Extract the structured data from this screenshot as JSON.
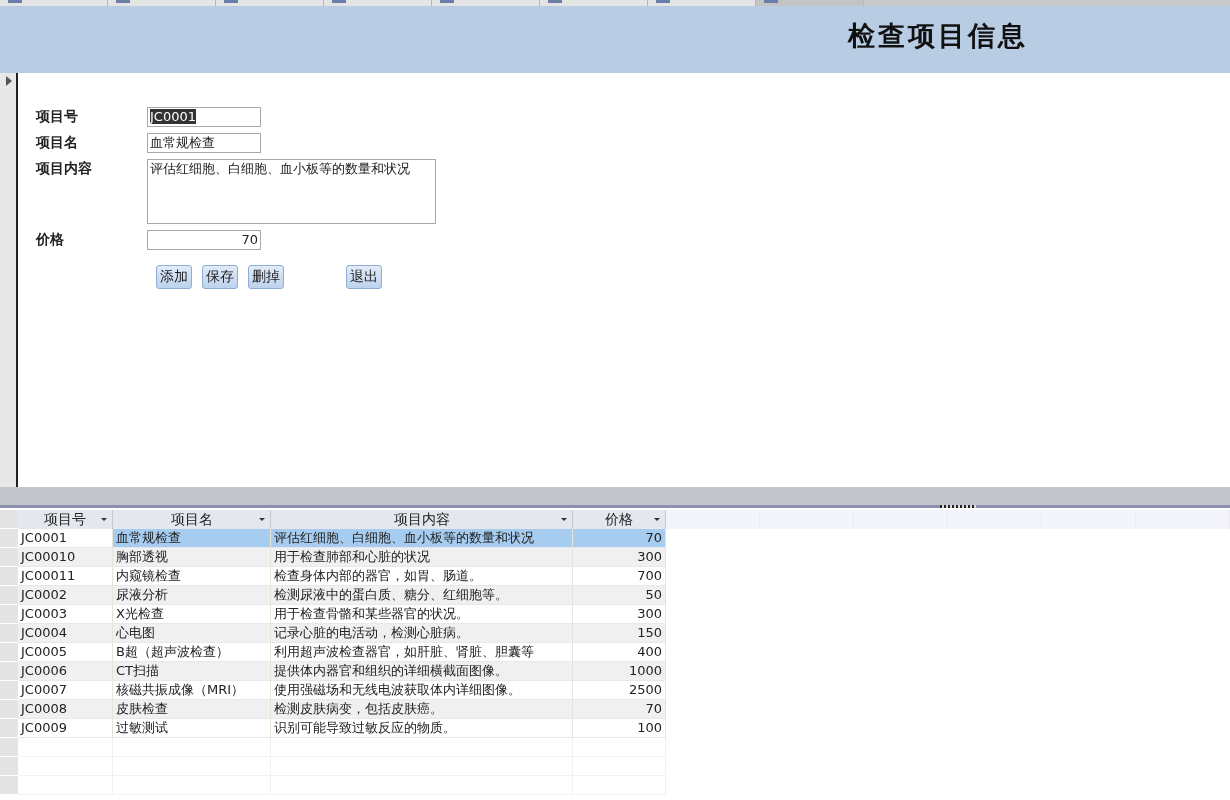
{
  "document_tabs": [
    {
      "selected": false
    },
    {
      "selected": false
    },
    {
      "selected": false
    },
    {
      "selected": false
    },
    {
      "selected": false
    },
    {
      "selected": false
    },
    {
      "selected": false
    },
    {
      "selected": true
    }
  ],
  "header": {
    "title": "检查项目信息"
  },
  "form": {
    "fields": [
      {
        "label": "项目号",
        "kind": "text",
        "value": "JC0001",
        "highlighted": true
      },
      {
        "label": "项目名",
        "kind": "text",
        "value": "血常规检查",
        "highlighted": false
      },
      {
        "label": "项目内容",
        "kind": "textarea",
        "value": "评估红细胞、白细胞、血小板等的数量和状况",
        "highlighted": false
      },
      {
        "label": "价格",
        "kind": "number",
        "value": "70",
        "highlighted": false
      }
    ],
    "buttons": [
      "添加",
      "保存",
      "删掉",
      "退出"
    ]
  },
  "table": {
    "columns": [
      "项目号",
      "项目名",
      "项目内容",
      "价格"
    ],
    "rows": [
      {
        "cells": [
          "JC0001",
          "血常规检查",
          "评估红细胞、白细胞、血小板等的数量和状况",
          "70"
        ],
        "selected": true
      },
      {
        "cells": [
          "JC00010",
          "胸部透视",
          "用于检查肺部和心脏的状况",
          "300"
        ],
        "selected": false
      },
      {
        "cells": [
          "JC00011",
          "内窥镜检查",
          "检查身体内部的器官，如胃、肠道。",
          "700"
        ],
        "selected": false
      },
      {
        "cells": [
          "JC0002",
          "尿液分析",
          "检测尿液中的蛋白质、糖分、红细胞等。",
          "50"
        ],
        "selected": false
      },
      {
        "cells": [
          "JC0003",
          "X光检查",
          "用于检查骨骼和某些器官的状况。",
          "300"
        ],
        "selected": false
      },
      {
        "cells": [
          "JC0004",
          "心电图",
          "记录心脏的电活动，检测心脏病。",
          "150"
        ],
        "selected": false
      },
      {
        "cells": [
          "JC0005",
          "B超（超声波检查）",
          "利用超声波检查器官，如肝脏、肾脏、胆囊等",
          "400"
        ],
        "selected": false
      },
      {
        "cells": [
          "JC0006",
          "CT扫描",
          "提供体内器官和组织的详细横截面图像。",
          "1000"
        ],
        "selected": false
      },
      {
        "cells": [
          "JC0007",
          "核磁共振成像（MRI）",
          "使用强磁场和无线电波获取体内详细图像。",
          "2500"
        ],
        "selected": false
      },
      {
        "cells": [
          "JC0008",
          "皮肤检查",
          "检测皮肤病变，包括皮肤癌。",
          "70"
        ],
        "selected": false
      },
      {
        "cells": [
          "JC0009",
          "过敏测试",
          "识别可能导致过敏反应的物质。",
          "100"
        ],
        "selected": false
      }
    ]
  }
}
